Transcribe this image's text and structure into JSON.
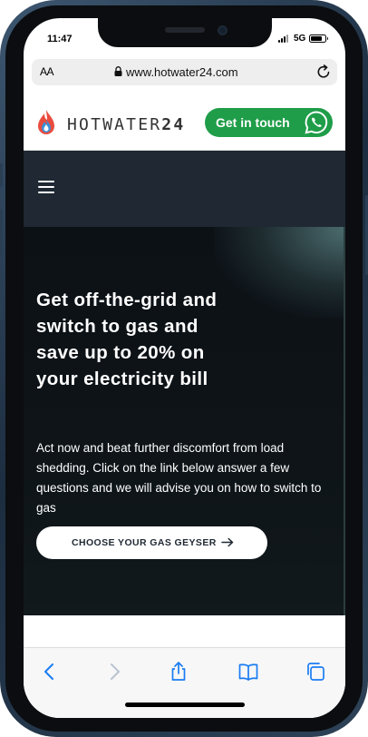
{
  "status_bar": {
    "time": "11:47",
    "network": "5G",
    "battery_level": 0.85
  },
  "browser": {
    "text_size_label": "AA",
    "url": "www.hotwater24.com"
  },
  "site_header": {
    "logo_text_light": "HOTWATER",
    "logo_text_bold": "24",
    "cta_label": "Get in touch",
    "cta_color": "#1f9d49",
    "icons": [
      "flame-logo-icon",
      "whatsapp-icon"
    ]
  },
  "nav": {
    "background": "#1f2833",
    "icon": "hamburger-menu-icon"
  },
  "hero": {
    "title": "Get off-the-grid and switch to gas and save up to 20% on your electricity bill",
    "body": "Act now and beat further discomfort from load shedding. Click on the link below answer a few questions and we will advise you on how to switch to gas",
    "button_label": "CHOOSE YOUR GAS GEYSER",
    "button_icon": "arrow-right-icon"
  },
  "toolbar": {
    "icons": [
      "back-icon",
      "forward-icon",
      "share-icon",
      "bookmarks-icon",
      "tabs-icon"
    ],
    "accent": "#1a7cf2"
  }
}
